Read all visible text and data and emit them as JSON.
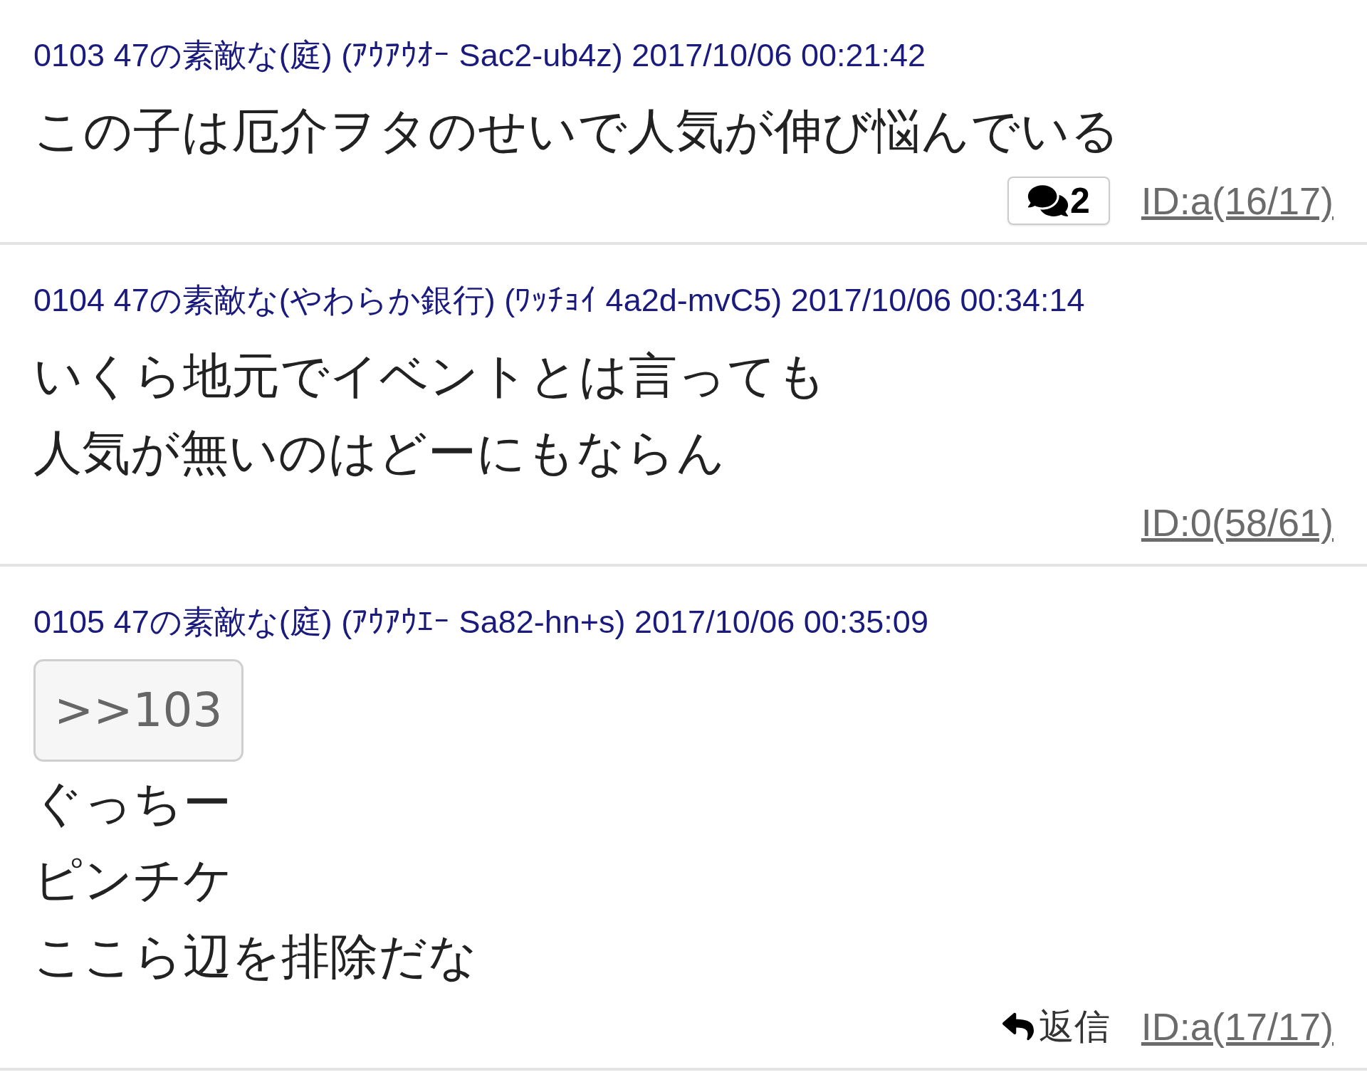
{
  "posts": [
    {
      "header": "0103 47の素敵な(庭) (ｱｳｱｳｵｰ Sac2-ub4z) 2017/10/06 00:21:42",
      "lines": [
        "この子は厄介ヲタのせいで人気が伸び悩んでいる"
      ],
      "reply_count": "2",
      "id": "ID:a(16/17)"
    },
    {
      "header": "0104 47の素敵な(やわらか銀行) (ﾜｯﾁｮｲ 4a2d-mvC5) 2017/10/06 00:34:14",
      "lines": [
        "いくら地元でイベントとは言っても",
        "人気が無いのはどーにもならん"
      ],
      "id": "ID:0(58/61)"
    },
    {
      "header": "0105 47の素敵な(庭) (ｱｳｱｳｴｰ Sa82-hn+s) 2017/10/06 00:35:09",
      "quote": ">>103",
      "lines": [
        "ぐっちー",
        "ピンチケ",
        "ここら辺を排除だな"
      ],
      "reply_label": "返信",
      "id": "ID:a(17/17)"
    }
  ]
}
